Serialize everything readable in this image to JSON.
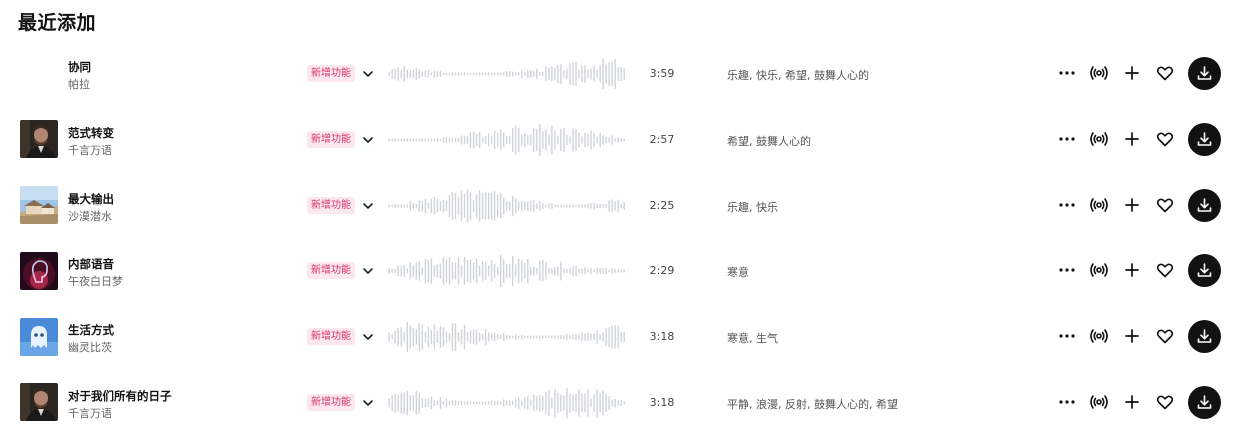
{
  "section_title": "最近添加",
  "badge_label": "新增功能",
  "accent_badge_bg": "#fde7ef",
  "accent_badge_text": "#d6336c",
  "download_button_bg": "#121212",
  "tracks": [
    {
      "title": "协同",
      "artist": "帕拉",
      "duration": "3:59",
      "tags": "乐趣, 快乐, 希望, 鼓舞人心的",
      "cover": "none"
    },
    {
      "title": "范式转变",
      "artist": "千言万语",
      "duration": "2:57",
      "tags": "希望, 鼓舞人心的",
      "cover": "portrait-man"
    },
    {
      "title": "最大输出",
      "artist": "沙漠潜水",
      "duration": "2:25",
      "tags": "乐趣, 快乐",
      "cover": "landscape-houses"
    },
    {
      "title": "内部语音",
      "artist": "午夜白日梦",
      "duration": "2:29",
      "tags": "寒意",
      "cover": "neon-head"
    },
    {
      "title": "生活方式",
      "artist": "幽灵比茨",
      "duration": "3:18",
      "tags": "寒意, 生气",
      "cover": "ghost"
    },
    {
      "title": "对于我们所有的日子",
      "artist": "千言万语",
      "duration": "3:18",
      "tags": "平静, 浪漫, 反射, 鼓舞人心的, 希望",
      "cover": "portrait-man"
    }
  ],
  "icons": {
    "more": "more-horizontal-icon",
    "radio": "radio-broadcast-icon",
    "add": "plus-icon",
    "like": "heart-icon",
    "download": "download-icon",
    "expand": "chevron-down-icon"
  }
}
